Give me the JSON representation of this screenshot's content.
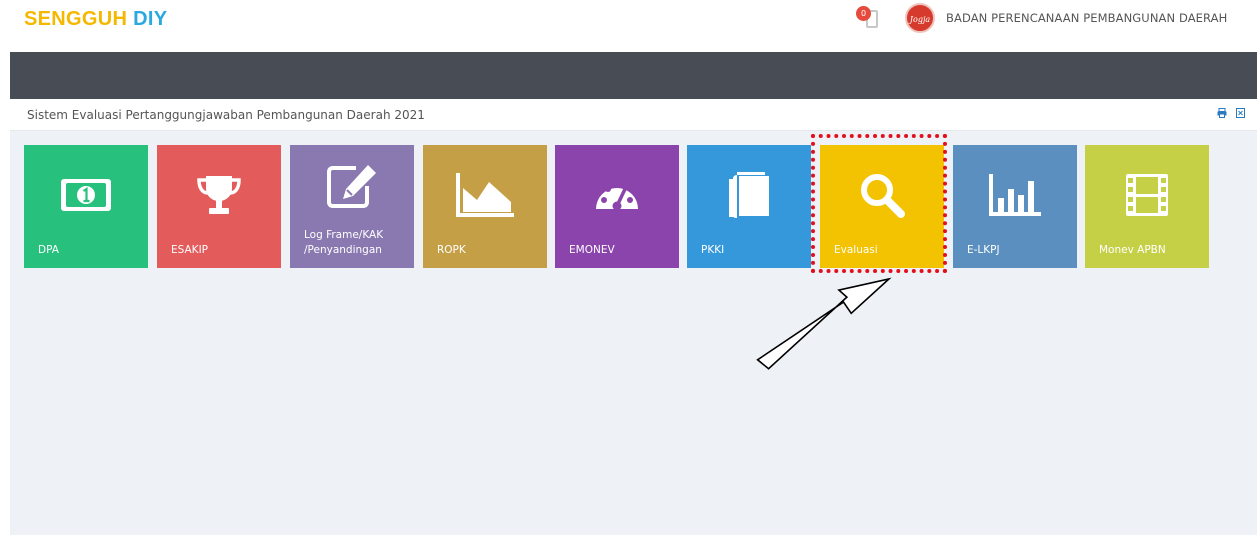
{
  "header": {
    "logo_part1": "SENGGUH",
    "logo_part2": "DIY",
    "notification_count": "0",
    "avatar_text": "Jogja",
    "org_name": "BADAN PERENCANAAN PEMBANGUNAN DAERAH"
  },
  "breadcrumb": {
    "title": "Sistem Evaluasi Pertanggungjawaban Pembangunan Daerah 2021",
    "print_icon": "print-icon",
    "export_icon": "export-icon"
  },
  "tiles": [
    {
      "label": "DPA",
      "icon": "money-icon",
      "color": "#27c07d"
    },
    {
      "label": "ESAKIP",
      "icon": "trophy-icon",
      "color": "#e45b5b"
    },
    {
      "label": "Log Frame/KAK",
      "label2": "/Penyandingan",
      "icon": "edit-icon",
      "color": "#8a78b0"
    },
    {
      "label": "ROPK",
      "icon": "area-chart-icon",
      "color": "#c49f45"
    },
    {
      "label": "EMONEV",
      "icon": "dashboard-icon",
      "color": "#8c44ad"
    },
    {
      "label": "PKKI",
      "icon": "book-icon",
      "color": "#3498db"
    },
    {
      "label": "Evaluasi",
      "icon": "search-icon",
      "color": "#f3c200"
    },
    {
      "label": "E-LKPJ",
      "icon": "bar-chart-icon",
      "color": "#5b8fbf"
    },
    {
      "label": "Monev APBN",
      "icon": "film-icon",
      "color": "#c5d046"
    }
  ],
  "annotation": {
    "highlight_color": "#e2101c",
    "highlighted_tile": "Evaluasi"
  }
}
